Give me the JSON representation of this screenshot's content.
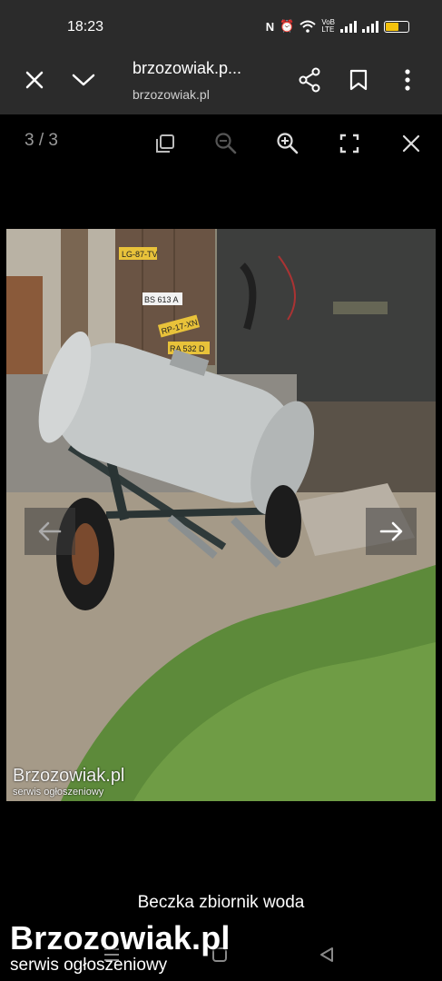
{
  "status_bar": {
    "time": "18:23",
    "icons": [
      "nfc-icon",
      "alarm-icon",
      "wifi-icon",
      "volte-icon",
      "signal-icon",
      "signal-icon",
      "battery-icon"
    ],
    "battery_level": 0.6,
    "battery_color": "#f4c20d"
  },
  "header": {
    "title": "brzozowiak.p...",
    "url": "brzozowiak.pl",
    "close_icon": "close-icon",
    "collapse_icon": "chevron-down-icon",
    "share_icon": "share-icon",
    "bookmark_icon": "bookmark-icon",
    "menu_icon": "more-vert-icon"
  },
  "viewer": {
    "counter": "3 / 3",
    "tools": [
      "copy-icon",
      "zoom-out-icon",
      "zoom-in-icon",
      "fullscreen-icon",
      "close-icon"
    ]
  },
  "photo": {
    "watermark_title": "Brzozowiak.pl",
    "watermark_subtitle": "serwis ogłoszeniowy",
    "plates": [
      "LG-87-TV",
      "BS 613 A",
      "RP-17-XN",
      "RA 532 D"
    ]
  },
  "caption": "Beczka zbiornik woda",
  "footer_brand": {
    "title": "Brzozowiak.pl",
    "subtitle": "serwis ogłoszeniowy"
  }
}
